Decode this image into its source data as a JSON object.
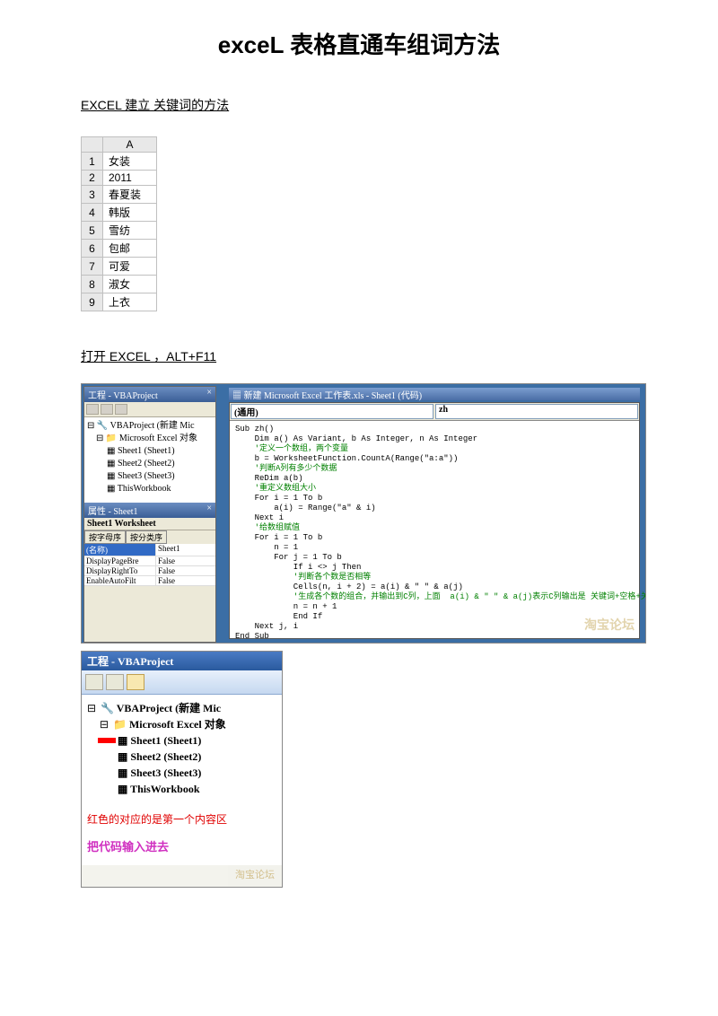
{
  "title": "exceL 表格直通车组词方法",
  "heading1": "EXCEL 建立  关键词的方法",
  "excel_col": "A",
  "excel_rows": [
    {
      "n": "1",
      "v": "女装"
    },
    {
      "n": "2",
      "v": "2011"
    },
    {
      "n": "3",
      "v": "春夏装"
    },
    {
      "n": "4",
      "v": "韩版"
    },
    {
      "n": "5",
      "v": "雪纺"
    },
    {
      "n": "6",
      "v": "包邮"
    },
    {
      "n": "7",
      "v": "可爱"
    },
    {
      "n": "8",
      "v": "淑女"
    },
    {
      "n": "9",
      "v": "上衣"
    }
  ],
  "heading2": "打开 EXCEL   ，ALT+F11",
  "vba1": {
    "project_title": "工程 - VBAProject",
    "close": "×",
    "tree_root": "VBAProject (新建 Mic",
    "tree_folder": "Microsoft Excel 对象",
    "tree_s1": "Sheet1 (Sheet1)",
    "tree_s2": "Sheet2 (Sheet2)",
    "tree_s3": "Sheet3 (Sheet3)",
    "tree_wb": "ThisWorkbook",
    "props_title": "属性 - Sheet1",
    "props_obj": "Sheet1 Worksheet",
    "tab1": "按字母序",
    "tab2": "按分类序",
    "p_name": "(名称)",
    "p_name_v": "Sheet1",
    "p_dpb": "DisplayPageBre",
    "p_dpb_v": "False",
    "p_drt": "DisplayRightTo",
    "p_drt_v": "False",
    "p_eaf": "EnableAutoFilt",
    "p_eaf_v": "False",
    "code_title": "新建 Microsoft Excel 工作表.xls - Sheet1 (代码)",
    "dd1": "(通用)",
    "dd2": "zh",
    "code_l1": "Sub zh()",
    "code_l2": "    Dim a() As Variant, b As Integer, n As Integer",
    "code_c1": "    '定义一个数组，两个变量",
    "code_l3": "    b = WorksheetFunction.CountA(Range(\"a:a\"))",
    "code_c2": "    '判断A列有多少个数据",
    "code_l4": "    ReDim a(b)",
    "code_c3": "    '重定义数组大小",
    "code_l5": "    For i = 1 To b",
    "code_l6": "        a(i) = Range(\"a\" & i)",
    "code_l7": "    Next i",
    "code_c4": "    '给数组赋值",
    "code_l8": "    For i = 1 To b",
    "code_l9": "        n = 1",
    "code_l10": "        For j = 1 To b",
    "code_l11": "            If i <> j Then",
    "code_c5": "            '判断各个数是否相等",
    "code_l12": "            Cells(n, i + 2) = a(i) & \" \" & a(j)",
    "code_c6": "            '生成各个数的组合，并输出到C列，上面  a(i) & \" \" & a(j)表示C列输出是 关键词+空格+关键词。",
    "code_l13": "            n = n + 1",
    "code_l14": "            End If",
    "code_l15": "    Next j, i",
    "code_l16": "End Sub",
    "watermark": "淘宝论坛"
  },
  "vba2": {
    "title": "工程 - VBAProject",
    "tree_root": "VBAProject (新建 Mic",
    "tree_folder": "Microsoft Excel 对象",
    "tree_s1": "Sheet1 (Sheet1)",
    "tree_s2": "Sheet2 (Sheet2)",
    "tree_s3": "Sheet3 (Sheet3)",
    "tree_wb": "ThisWorkbook",
    "note_red": "红色的对应的是第一个内容区",
    "note_pink": "把代码输入进去",
    "watermark": "淘宝论坛"
  }
}
